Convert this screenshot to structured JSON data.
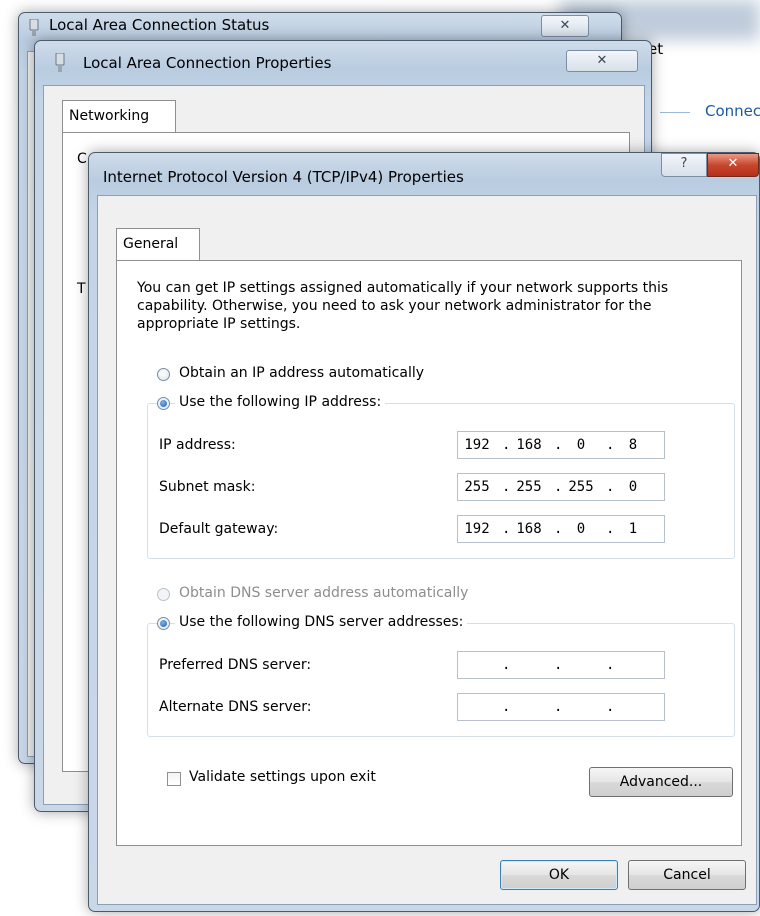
{
  "background": {
    "partial_text_top": "et",
    "partial_link": "Connec"
  },
  "status_window": {
    "title": "Local Area Connection Status",
    "close_glyph": "✕"
  },
  "properties_window": {
    "title": "Local Area Connection Properties",
    "close_glyph": "✕",
    "tab": "Networking",
    "partial_text_1": "C",
    "partial_text_2": "T"
  },
  "ipv4_dialog": {
    "title": "Internet Protocol Version 4 (TCP/IPv4) Properties",
    "help_glyph": "?",
    "close_glyph": "✕",
    "tab": "General",
    "description": "You can get IP settings assigned automatically if your network supports this capability. Otherwise, you need to ask your network administrator for the appropriate IP settings.",
    "obtain_ip_auto": "Obtain an IP address automatically",
    "use_following_ip": "Use the following IP address:",
    "ip_address_label": "IP address:",
    "ip_address": [
      "192",
      "168",
      "0",
      "8"
    ],
    "subnet_mask_label": "Subnet mask:",
    "subnet_mask": [
      "255",
      "255",
      "255",
      "0"
    ],
    "default_gateway_label": "Default gateway:",
    "default_gateway": [
      "192",
      "168",
      "0",
      "1"
    ],
    "obtain_dns_auto": "Obtain DNS server address automatically",
    "use_following_dns": "Use the following DNS server addresses:",
    "preferred_dns_label": "Preferred DNS server:",
    "preferred_dns": [
      "",
      "",
      "",
      ""
    ],
    "alternate_dns_label": "Alternate DNS server:",
    "alternate_dns": [
      "",
      "",
      "",
      ""
    ],
    "validate_label": "Validate settings upon exit",
    "advanced_button": "Advanced...",
    "ok_button": "OK",
    "cancel_button": "Cancel",
    "dot": "."
  }
}
